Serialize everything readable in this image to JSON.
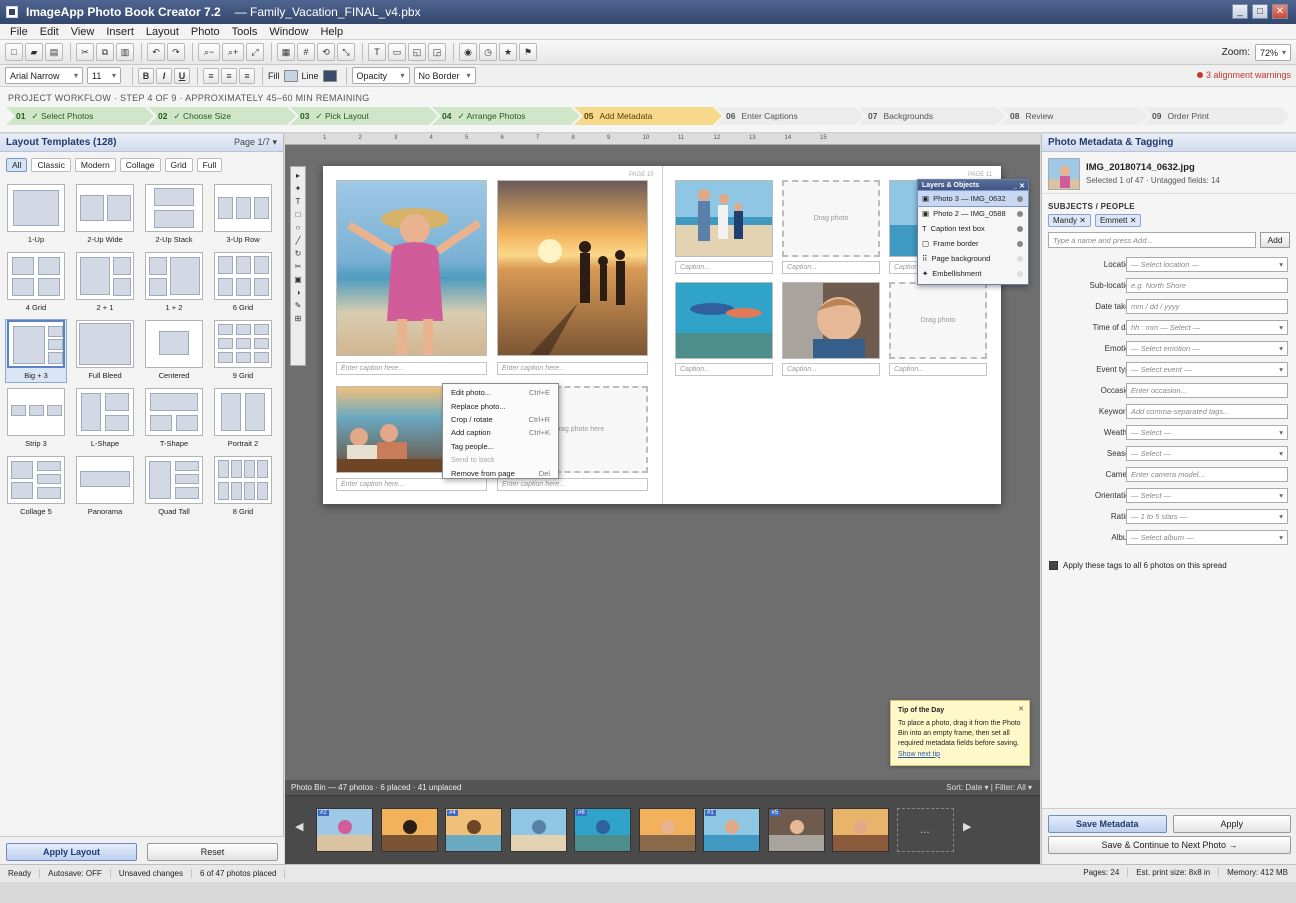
{
  "window": {
    "app_title": "ImageApp Photo Book Creator 7.2",
    "doc_title": "—  Family_Vacation_FINAL_v4.pbx",
    "min": "_",
    "max": "□",
    "close": "✕"
  },
  "menu": [
    "File",
    "Edit",
    "View",
    "Insert",
    "Layout",
    "Photo",
    "Tools",
    "Window",
    "Help"
  ],
  "toolbar": {
    "zoom_label": "Zoom:",
    "zoom_value": "72%"
  },
  "format": {
    "font": "Arial Narrow",
    "size": "11",
    "bold": "B",
    "italic": "I",
    "underline": "U",
    "fill_label": "Fill",
    "line_label": "Line",
    "opacity": "Opacity",
    "border": "No Border",
    "fill_color": "#c5d3e6",
    "line_color": "#3a4a6b",
    "warning": "3 alignment warnings"
  },
  "workflow": {
    "label": "PROJECT WORKFLOW   ·   STEP 4 OF 9   ·   APPROXIMATELY 45–60 MIN REMAINING",
    "steps": [
      {
        "num": "01",
        "label": "✓ Select Photos",
        "state": "done"
      },
      {
        "num": "02",
        "label": "✓ Choose Size",
        "state": "done"
      },
      {
        "num": "03",
        "label": "✓ Pick Layout",
        "state": "done"
      },
      {
        "num": "04",
        "label": "✓ Arrange Photos",
        "state": "done"
      },
      {
        "num": "05",
        "label": "Add Metadata",
        "state": "current"
      },
      {
        "num": "06",
        "label": "Enter Captions",
        "state": "todo"
      },
      {
        "num": "07",
        "label": "Backgrounds",
        "state": "todo"
      },
      {
        "num": "08",
        "label": "Review",
        "state": "todo"
      },
      {
        "num": "09",
        "label": "Order Print",
        "state": "todo"
      }
    ]
  },
  "left": {
    "title": "Layout Templates (128)",
    "page": "Page 1/7 ▾",
    "filters": [
      "All",
      "Classic",
      "Modern",
      "Collage",
      "Grid",
      "Full"
    ],
    "templates": [
      "1-Up",
      "2-Up Wide",
      "2-Up Stack",
      "3-Up Row",
      "4 Grid",
      "2 + 1",
      "1 + 2",
      "6 Grid",
      "Big + 3",
      "Full Bleed",
      "Centered",
      "9 Grid",
      "Strip 3",
      "L-Shape",
      "T-Shape",
      "Portrait 2",
      "Collage 5",
      "Panorama",
      "Quad Tall",
      "8 Grid"
    ],
    "apply": "Apply Layout",
    "reset": "Reset"
  },
  "canvas": {
    "ruler": [
      "1",
      "2",
      "3",
      "4",
      "5",
      "6",
      "7",
      "8",
      "9",
      "10",
      "11",
      "12",
      "13",
      "14",
      "15"
    ],
    "page_left": "PAGE 10",
    "page_right": "PAGE 11",
    "caption_placeholder": "Enter caption here...",
    "caption_short": "Caption...",
    "drag_photo": "Drag photo",
    "drag_photo_here": "drag photo here",
    "drop_icon": "⊞"
  },
  "layers": {
    "title": "Layers & Objects",
    "items": [
      {
        "icon": "▣",
        "label": "Photo 3 — IMG_0632"
      },
      {
        "icon": "▣",
        "label": "Photo 2 — IMG_0588"
      },
      {
        "icon": "T",
        "label": "Caption text box"
      },
      {
        "icon": "▢",
        "label": "Frame border"
      },
      {
        "icon": "⠿",
        "label": "Page background"
      },
      {
        "icon": "✦",
        "label": "Embellishment"
      }
    ]
  },
  "context_menu": [
    {
      "label": "Edit photo...",
      "shortcut": "Ctrl+E"
    },
    {
      "label": "Replace photo...",
      "shortcut": ""
    },
    {
      "label": "Crop / rotate",
      "shortcut": "Ctrl+R"
    },
    {
      "label": "Add caption",
      "shortcut": "Ctrl+K"
    },
    {
      "label": "Tag people...",
      "shortcut": ""
    },
    {
      "label": "Send to back",
      "shortcut": ""
    },
    {
      "label": "Remove from page",
      "shortcut": "Del"
    }
  ],
  "tip": {
    "title": "Tip of the Day",
    "body": "To place a photo, drag it from the Photo Bin into an empty frame, then set all required metadata fields before saving.",
    "link": "Show next tip",
    "close": "✕"
  },
  "photobin": {
    "summary": "Photo Bin — 47 photos · 6 placed · 41 unplaced",
    "sort": "Sort: Date ▾",
    "filter": "Filter: All ▾",
    "badges": [
      "#2",
      "#4",
      "#6",
      "#1",
      "#5"
    ],
    "more": "..."
  },
  "right": {
    "title": "Photo Metadata & Tagging",
    "filename": "IMG_20180714_0632.jpg",
    "fileinfo": "Selected 1 of 47 · Untagged fields: 14",
    "subjects_label": "SUBJECTS / PEOPLE",
    "people": [
      "Mandy ✕",
      "Emmett ✕"
    ],
    "add_placeholder": "Type a name and press Add...",
    "add_button": "Add",
    "fields": [
      {
        "label": "Location",
        "placeholder": "— Select location —",
        "dropdown": true
      },
      {
        "label": "Sub-location",
        "placeholder": "e.g. North Shore",
        "dropdown": false
      },
      {
        "label": "Date taken",
        "placeholder": "mm / dd / yyyy",
        "dropdown": false
      },
      {
        "label": "Time of day",
        "placeholder": "hh : mm — Select —",
        "dropdown": true
      },
      {
        "label": "Emotion",
        "placeholder": "— Select emotion —",
        "dropdown": true
      },
      {
        "label": "Event type",
        "placeholder": "— Select event —",
        "dropdown": true
      },
      {
        "label": "Occasion",
        "placeholder": "Enter occasion...",
        "dropdown": false
      },
      {
        "label": "Keywords",
        "placeholder": "Add comma-separated tags...",
        "dropdown": false
      },
      {
        "label": "Weather",
        "placeholder": "— Select —",
        "dropdown": true
      },
      {
        "label": "Season",
        "placeholder": "— Select —",
        "dropdown": true
      },
      {
        "label": "Camera",
        "placeholder": "Enter camera model...",
        "dropdown": false
      },
      {
        "label": "Orientation",
        "placeholder": "— Select —",
        "dropdown": true
      },
      {
        "label": "Rating",
        "placeholder": "— 1 to 5 stars —",
        "dropdown": true
      },
      {
        "label": "Album",
        "placeholder": "— Select album —",
        "dropdown": true
      }
    ],
    "apply_all": "Apply these tags to all 6 photos on this spread",
    "save": "Save Metadata",
    "apply": "Apply",
    "save_continue": "Save & Continue to Next Photo →"
  },
  "status": {
    "ready": "Ready",
    "autosave": "Autosave: OFF",
    "unsaved": "Unsaved changes",
    "placed": "6 of 47 photos placed",
    "pages": "Pages: 24",
    "print": "Est. print size: 8x8 in",
    "memory": "Memory: 412 MB"
  }
}
